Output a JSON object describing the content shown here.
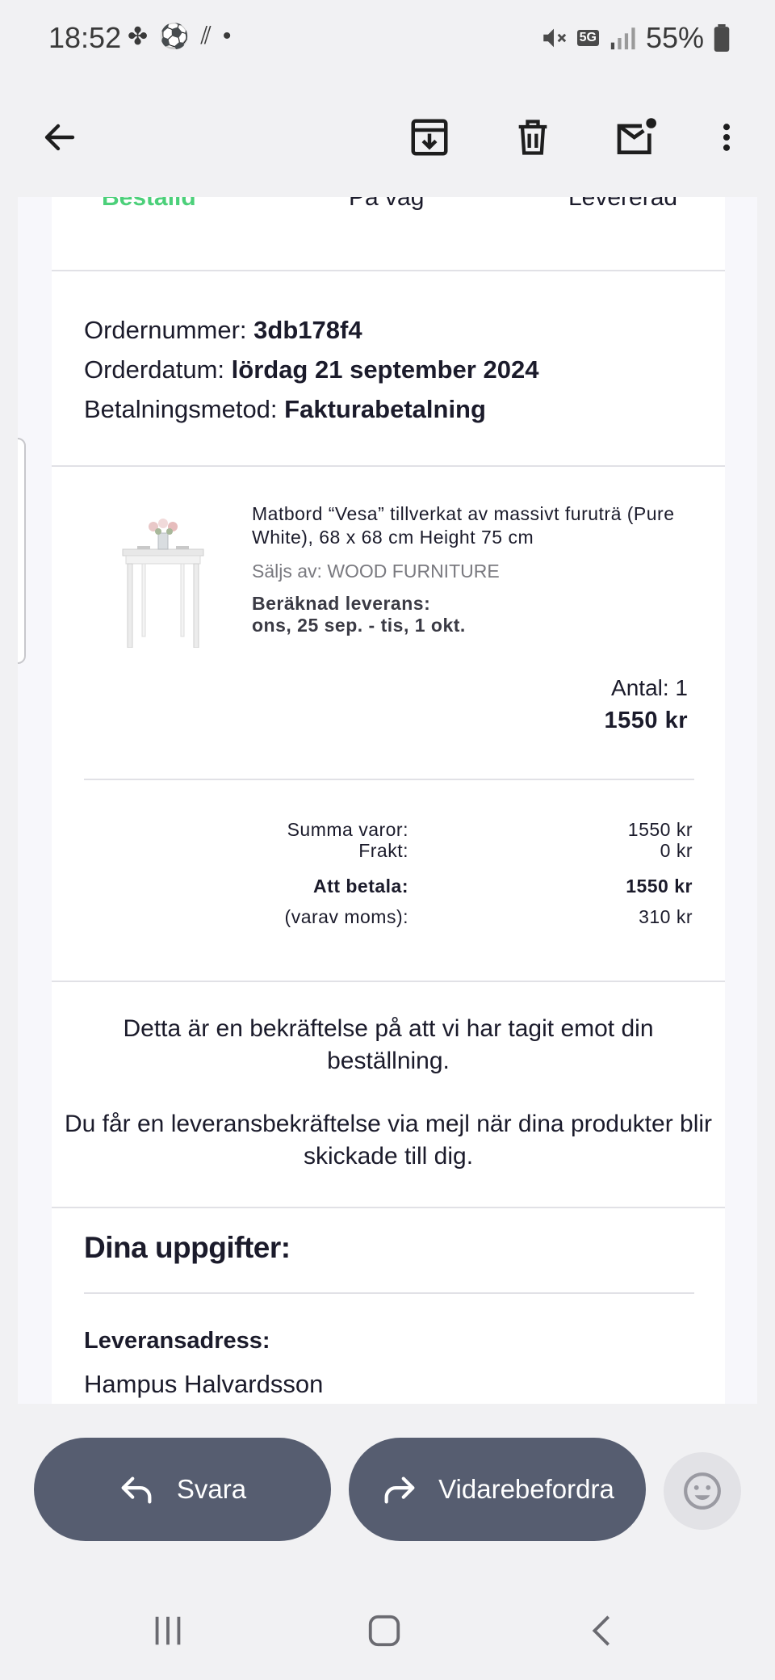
{
  "status_bar": {
    "time": "18:52",
    "battery": "55%",
    "network": "5G"
  },
  "toolbar": {
    "back_icon": "arrow-left-icon",
    "archive_icon": "archive-icon",
    "delete_icon": "trash-icon",
    "mark_unread_icon": "mail-unread-icon",
    "more_icon": "more-vert-icon"
  },
  "order_progress": {
    "steps": [
      "Beställd",
      "På väg",
      "Levererad"
    ],
    "active_color": "#4cd07a"
  },
  "order": {
    "number_label": "Ordernummer:",
    "number_value": "3db178f4",
    "date_label": "Orderdatum:",
    "date_value": "lördag 21 september 2024",
    "payment_label": "Betalningsmetod:",
    "payment_value": "Fakturabetalning"
  },
  "product": {
    "title": "Matbord “Vesa” tillverkat av massivt furuträ (Pure White), 68 x 68 cm Height 75 cm",
    "seller": "Säljs av: WOOD FURNITURE",
    "delivery_label": "Beräknad leverans:",
    "delivery_value": "ons, 25 sep. - tis, 1 okt.",
    "quantity": "Antal: 1",
    "price": "1550 kr"
  },
  "summary": {
    "subtotal_label": "Summa varor:",
    "subtotal_value": "1550 kr",
    "shipping_label": "Frakt:",
    "shipping_value": "0 kr",
    "total_label": "Att betala:",
    "total_value": "1550 kr",
    "vat_label": "(varav moms):",
    "vat_value": "310 kr"
  },
  "confirmation": {
    "line1": "Detta är en bekräftelse på att vi har tagit emot din beställning.",
    "line2": "Du får en leveransbekräftelse via mejl när dina produkter blir skickade till dig."
  },
  "details": {
    "title": "Dina uppgifter:",
    "address_label": "Leveransadress:",
    "name": "Hampus Halvardsson"
  },
  "actions": {
    "reply_label": "Svara",
    "forward_label": "Vidarebefordra"
  },
  "colors": {
    "pill_bg": "#565d70",
    "background": "#f1f1f3"
  }
}
